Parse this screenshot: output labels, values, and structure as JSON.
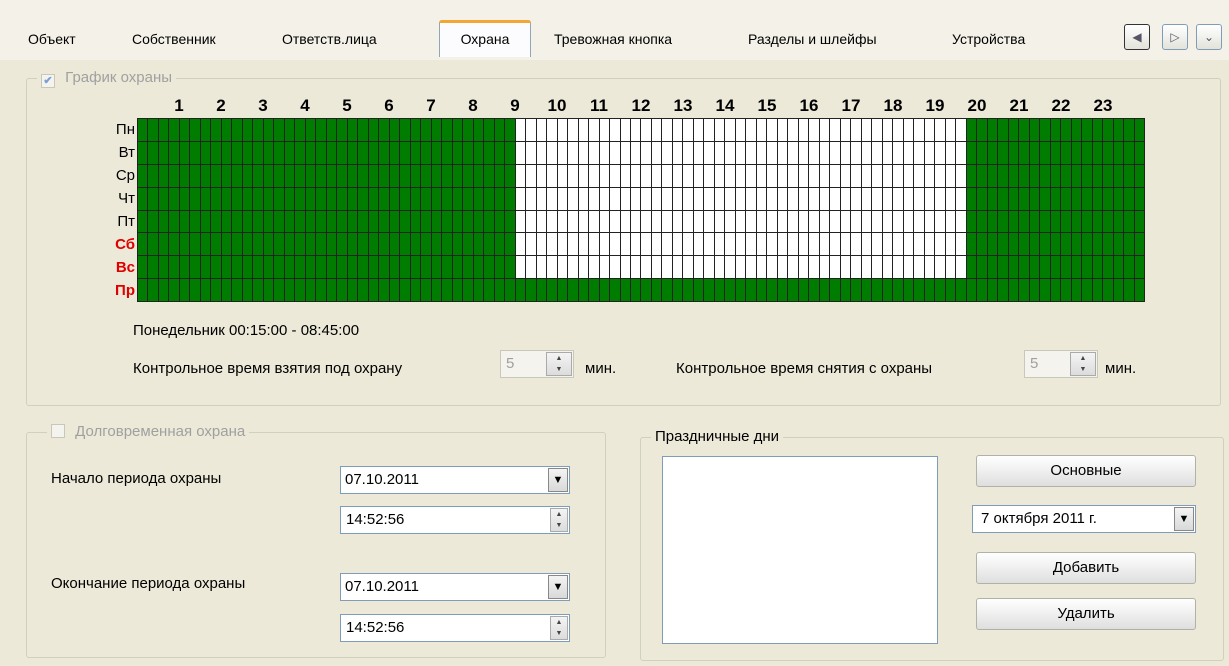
{
  "tabs": [
    {
      "label": "Объект",
      "active": false
    },
    {
      "label": "Собственник",
      "active": false
    },
    {
      "label": "Ответств.лица",
      "active": false
    },
    {
      "label": "Охрана",
      "active": true
    },
    {
      "label": "Тревожная кнопка",
      "active": false
    },
    {
      "label": "Разделы и шлейфы",
      "active": false
    },
    {
      "label": "Устройства",
      "active": false
    }
  ],
  "nav": {
    "prev_icon": "arrow-left-icon",
    "next_icon": "arrow-right-icon",
    "menu_icon": "chevron-down-icon"
  },
  "schedule": {
    "legend": "График охраны",
    "checked": true,
    "hours": [
      "1",
      "2",
      "3",
      "4",
      "5",
      "6",
      "7",
      "8",
      "9",
      "10",
      "11",
      "12",
      "13",
      "14",
      "15",
      "16",
      "17",
      "18",
      "19",
      "20",
      "21",
      "22",
      "23"
    ],
    "days": [
      {
        "label": "Пн",
        "holiday": false
      },
      {
        "label": "Вт",
        "holiday": false
      },
      {
        "label": "Ср",
        "holiday": false
      },
      {
        "label": "Чт",
        "holiday": false
      },
      {
        "label": "Пт",
        "holiday": false
      },
      {
        "label": "Сб",
        "holiday": true
      },
      {
        "label": "Вс",
        "holiday": true
      },
      {
        "label": "Пр",
        "holiday": true
      }
    ],
    "slots_per_day": 96,
    "guard_on_color": "#007c00",
    "guard_off_color": "#ffffff",
    "rows_guard_ranges": [
      [
        [
          0,
          36
        ],
        [
          79,
          96
        ]
      ],
      [
        [
          0,
          36
        ],
        [
          79,
          96
        ]
      ],
      [
        [
          0,
          36
        ],
        [
          79,
          96
        ]
      ],
      [
        [
          0,
          36
        ],
        [
          79,
          96
        ]
      ],
      [
        [
          0,
          36
        ],
        [
          79,
          96
        ]
      ],
      [
        [
          0,
          36
        ],
        [
          79,
          96
        ]
      ],
      [
        [
          0,
          36
        ],
        [
          79,
          96
        ]
      ],
      [
        [
          0,
          96
        ]
      ]
    ],
    "selection_info": "Понедельник  00:15:00 - 08:45:00",
    "arm_label": "Контрольное время взятия под охрану",
    "arm_value": "5",
    "arm_unit": "мин.",
    "disarm_label": "Контрольное время снятия с охраны",
    "disarm_value": "5",
    "disarm_unit": "мин."
  },
  "longterm": {
    "legend": "Долговременная охрана",
    "checked": false,
    "start_label": "Начало периода охраны",
    "start_date": "07.10.2011",
    "start_time": "14:52:56",
    "end_label": "Окончание периода охраны",
    "end_date": "07.10.2011",
    "end_time": "14:52:56"
  },
  "holidays": {
    "legend": "Праздничные дни",
    "main_button": "Основные",
    "date_value": "7  октября  2011 г.",
    "add_button": "Добавить",
    "delete_button": "Удалить"
  }
}
